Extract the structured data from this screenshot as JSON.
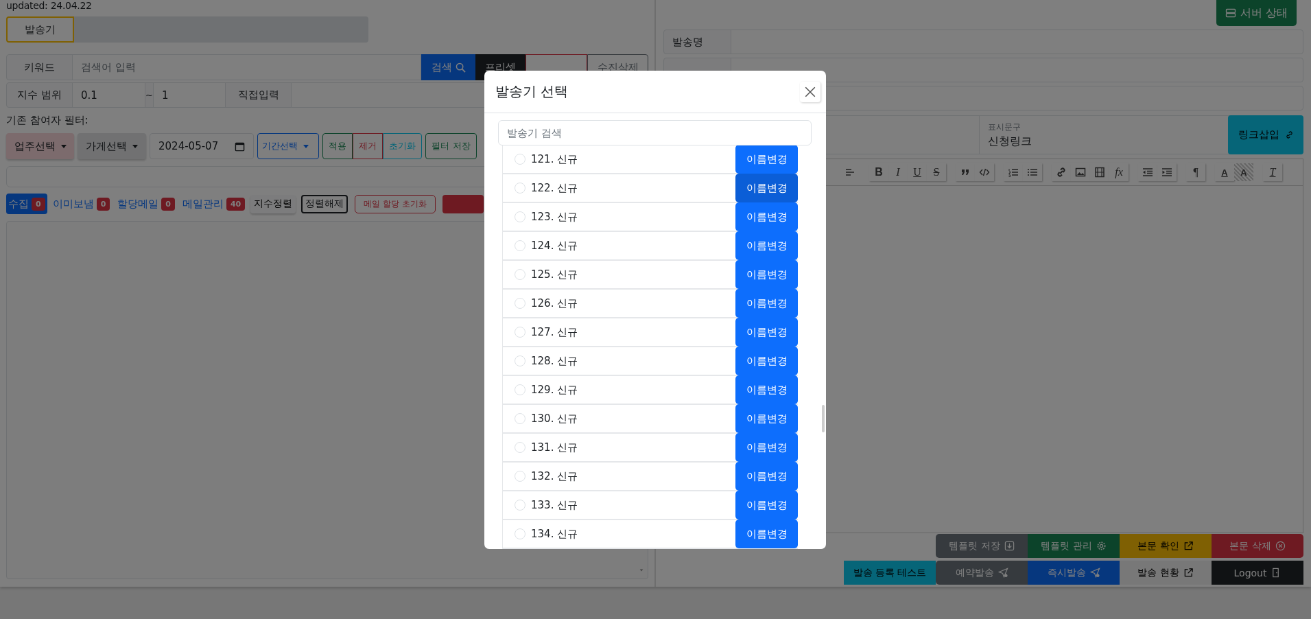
{
  "updated": "updated: 24.04.22",
  "sender_tab": {
    "label": "발송기",
    "selected": true
  },
  "keyword": {
    "label": "키워드",
    "placeholder": "검색어 입력"
  },
  "keyword_buttons": [
    {
      "label": "검색",
      "kind": "search"
    },
    {
      "label": "프리셋",
      "kind": "dark"
    },
    {
      "kind": "danger-outline"
    },
    {
      "label": "수진삭제",
      "kind": "secondary-outline"
    }
  ],
  "range": {
    "label": "지수 범위",
    "min": "0.1",
    "separator": "~",
    "max": "1",
    "manual_label": "직접입력"
  },
  "filter_title": "기존 참여자 필터:",
  "filters": [
    {
      "kind": "owner-select",
      "label": "업주선택"
    },
    {
      "kind": "store-select",
      "label": "가게선택"
    },
    {
      "kind": "date",
      "value": "2024-05-07"
    },
    {
      "kind": "period-select",
      "label": "기간선택"
    },
    {
      "kind": "success-outline",
      "label": "적용"
    },
    {
      "kind": "danger-outline",
      "label": "제거"
    },
    {
      "kind": "info-outline",
      "label": "초기화"
    },
    {
      "kind": "save-outline",
      "label": "필터 저장"
    }
  ],
  "counters": [
    {
      "label": "수집",
      "count": "0",
      "selected": true
    },
    {
      "label": "이미보냄",
      "count": "0",
      "selected": false
    },
    {
      "label": "할당메일",
      "count": "0",
      "selected": false
    },
    {
      "label": "메일관리",
      "count": "40",
      "selected": false
    }
  ],
  "sort_buttons": [
    {
      "label": "지수정렬",
      "kind": "light"
    },
    {
      "label": "정렬해제",
      "kind": "dark-outline"
    },
    {
      "label": "메일 할당 초기화",
      "kind": "danger-outline"
    },
    {
      "kind": "danger"
    }
  ],
  "server_button": {
    "label": "서버 상태"
  },
  "fields": [
    {
      "kind": "labeled",
      "label": "발송명"
    },
    {
      "kind": "covered"
    },
    {
      "kind": "plain"
    }
  ],
  "link_row": {
    "display_label": "표시문구",
    "display_value": "신청링크",
    "button": "링크삽입"
  },
  "toolbar": [
    [
      {
        "kind": "align"
      }
    ],
    [
      {
        "kind": "bold",
        "glyph": "B"
      },
      {
        "kind": "italic",
        "glyph": "I"
      },
      {
        "kind": "underline",
        "glyph": "U"
      },
      {
        "kind": "strike",
        "glyph": "S"
      }
    ],
    [
      {
        "kind": "quote"
      },
      {
        "kind": "code"
      }
    ],
    [
      {
        "kind": "ordered-list"
      },
      {
        "kind": "bullet-list"
      }
    ],
    [
      {
        "kind": "link"
      },
      {
        "kind": "image"
      },
      {
        "kind": "video"
      },
      {
        "kind": "formula",
        "glyph": "fx"
      }
    ],
    [
      {
        "kind": "outdent"
      },
      {
        "kind": "indent"
      }
    ],
    [
      {
        "kind": "direction",
        "glyph": "¶"
      }
    ],
    [
      {
        "kind": "text-color",
        "glyph": "A"
      },
      {
        "kind": "highlight",
        "glyph": "A"
      }
    ],
    [
      {
        "kind": "clear-format",
        "glyph": "T"
      }
    ]
  ],
  "action_rows": [
    [
      {
        "label": "템플릿 저장",
        "kind": "secondary"
      },
      {
        "label": "템플릿 관리",
        "kind": "success"
      },
      {
        "label": "본문 확인",
        "kind": "warning"
      },
      {
        "label": "본문 삭제",
        "kind": "danger"
      }
    ],
    [
      {
        "label": "발송 등록 테스트",
        "kind": "info"
      },
      {
        "label": "예약발송",
        "kind": "secondary"
      },
      {
        "label": "즉시발송",
        "kind": "primary"
      },
      {
        "label": "발송 현황",
        "kind": "light"
      },
      {
        "label": "Logout",
        "kind": "dark"
      }
    ]
  ],
  "modal": {
    "title": "발송기 선택",
    "search_placeholder": "발송기 검색",
    "items": [
      {
        "label": "121. 신규",
        "button": "이름변경",
        "selected": false,
        "hovered": false
      },
      {
        "label": "122. 신규",
        "button": "이름변경",
        "selected": false,
        "hovered": true
      },
      {
        "label": "123. 신규",
        "button": "이름변경",
        "selected": false,
        "hovered": false
      },
      {
        "label": "124. 신규",
        "button": "이름변경",
        "selected": false,
        "hovered": false
      },
      {
        "label": "125. 신규",
        "button": "이름변경",
        "selected": false,
        "hovered": false
      },
      {
        "label": "126. 신규",
        "button": "이름변경",
        "selected": false,
        "hovered": false
      },
      {
        "label": "127. 신규",
        "button": "이름변경",
        "selected": false,
        "hovered": false
      },
      {
        "label": "128. 신규",
        "button": "이름변경",
        "selected": false,
        "hovered": false
      },
      {
        "label": "129. 신규",
        "button": "이름변경",
        "selected": false,
        "hovered": false
      },
      {
        "label": "130. 신규",
        "button": "이름변경",
        "selected": false,
        "hovered": false
      },
      {
        "label": "131. 신규",
        "button": "이름변경",
        "selected": false,
        "hovered": false
      },
      {
        "label": "132. 신규",
        "button": "이름변경",
        "selected": false,
        "hovered": false
      },
      {
        "label": "133. 신규",
        "button": "이름변경",
        "selected": false,
        "hovered": false
      },
      {
        "label": "134. 신규",
        "button": "이름변경",
        "selected": false,
        "hovered": false
      }
    ]
  }
}
